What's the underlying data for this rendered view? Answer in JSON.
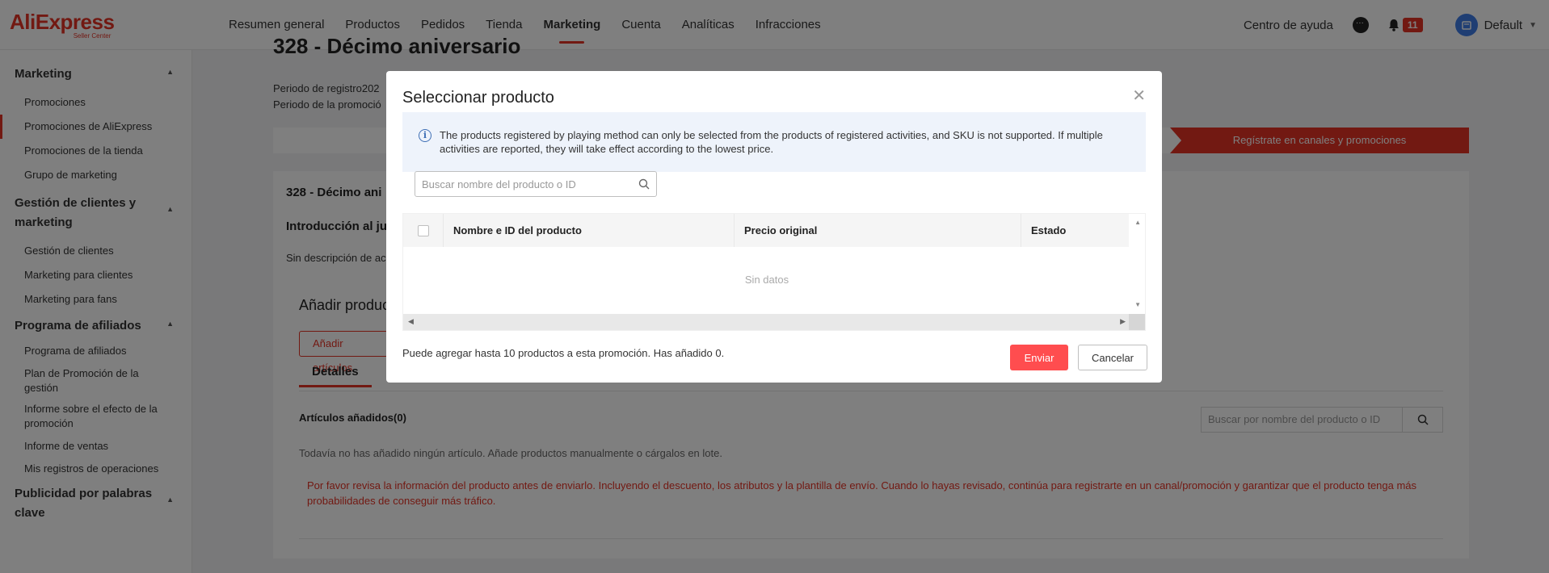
{
  "header": {
    "logo": "AliExpress",
    "logo_sub": "Seller Center",
    "nav": [
      "Resumen general",
      "Productos",
      "Pedidos",
      "Tienda",
      "Marketing",
      "Cuenta",
      "Analíticas",
      "Infracciones"
    ],
    "help": "Centro de ayuda",
    "notif_count": "11",
    "user": "Default"
  },
  "sidebar": {
    "marketing": {
      "title": "Marketing",
      "items": [
        "Promociones",
        "Promociones de AliExpress",
        "Promociones de la tienda",
        "Grupo de marketing"
      ]
    },
    "clients": {
      "title": "Gestión de clientes y marketing",
      "items": [
        "Gestión de clientes",
        "Marketing para clientes",
        "Marketing para fans"
      ]
    },
    "affiliates": {
      "title": "Programa de afiliados",
      "items": [
        "Programa de afiliados",
        "Plan de Promoción de la gestión",
        "Informe sobre el efecto de la promoción",
        "Informe de ventas",
        "Mis registros de operaciones"
      ]
    },
    "ads": {
      "title": "Publicidad por palabras clave"
    }
  },
  "page": {
    "title": "328 - Décimo aniversario",
    "period_registration": "Periodo de registro202",
    "period_promo": "Periodo de la promoció",
    "step_active": "Regístrate en canales y promociones",
    "card_title": "328 - Décimo ani",
    "intro_title": "Introducción al ju",
    "no_desc": "Sin descripción de ac",
    "add_title": "Añadir produc",
    "add_btn": "Añadir artículos",
    "tab_details": "Detalles",
    "added_label": "Artículos añadidos(0)",
    "search_placeholder": "Buscar por nombre del producto o ID",
    "empty_msg": "Todavía no has añadido ningún artículo. Añade productos manualmente o cárgalos en lote.",
    "warn_msg": "Por favor revisa la información del producto antes de enviarlo. Incluyendo el descuento, los atributos y la plantilla de envío. Cuando lo hayas revisado, continúa para registrarte en un canal/promoción y garantizar que el producto tenga más probabilidades de conseguir más tráfico."
  },
  "modal": {
    "title": "Seleccionar producto",
    "notice": "The products registered by playing method can only be selected from the products of registered activities, and SKU is not supported. If multiple activities are reported, they will take effect according to the lowest price.",
    "search_placeholder": "Buscar nombre del producto o ID",
    "columns": [
      "Nombre e ID del producto",
      "Precio original",
      "Estado"
    ],
    "no_data": "Sin datos",
    "footer": "Puede agregar hasta 10 productos a esta promoción. Has añadido 0.",
    "submit": "Enviar",
    "cancel": "Cancelar"
  }
}
